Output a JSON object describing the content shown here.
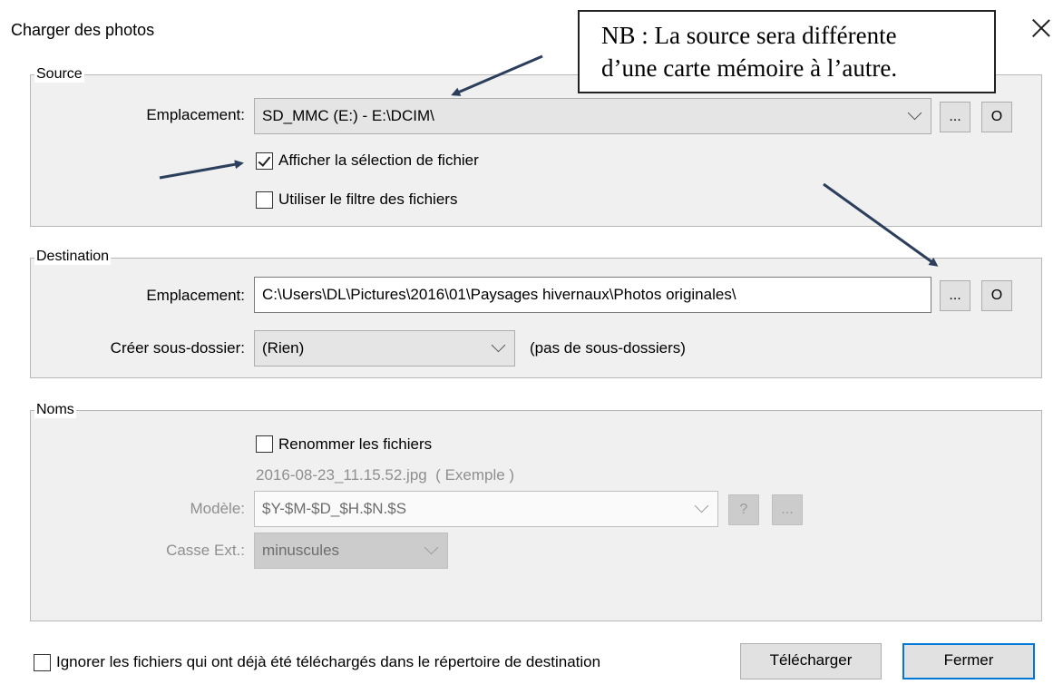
{
  "window": {
    "title": "Charger des photos"
  },
  "note": {
    "line1": "NB : La source sera différente",
    "line2": "d’une carte mémoire à l’autre."
  },
  "source": {
    "legend": "Source",
    "location_label": "Emplacement:",
    "location_value": "SD_MMC (E:) - E:\\DCIM\\",
    "browse_label": "...",
    "open_label": "O",
    "show_selection": {
      "label": "Afficher la sélection de fichier",
      "checked": true
    },
    "use_filter": {
      "label": "Utiliser le filtre des fichiers",
      "checked": false
    }
  },
  "destination": {
    "legend": "Destination",
    "location_label": "Emplacement:",
    "location_value": "C:\\Users\\DL\\Pictures\\2016\\01\\Paysages hivernaux\\Photos originales\\",
    "browse_label": "...",
    "open_label": "O",
    "subfolder_label": "Créer sous-dossier:",
    "subfolder_value": "(Rien)",
    "subfolder_hint": "(pas de sous-dossiers)"
  },
  "names": {
    "legend": "Noms",
    "rename": {
      "label": "Renommer les fichiers",
      "checked": false
    },
    "example": "2016-08-23_11.15.52.jpg  ( Exemple )",
    "model_label": "Modèle:",
    "model_value": "$Y-$M-$D_$H.$N.$S",
    "help_label": "?",
    "more_label": "...",
    "case_label": "Casse Ext.:",
    "case_value": "minuscules"
  },
  "footer": {
    "ignore_label": "Ignorer les fichiers qui ont déjà été téléchargés dans le répertoire de destination",
    "ignore_checked": false,
    "download_label": "Télécharger",
    "close_label": "Fermer"
  },
  "colors": {
    "arrow": "#2b3f5c",
    "default_button_border": "#0078d7"
  }
}
